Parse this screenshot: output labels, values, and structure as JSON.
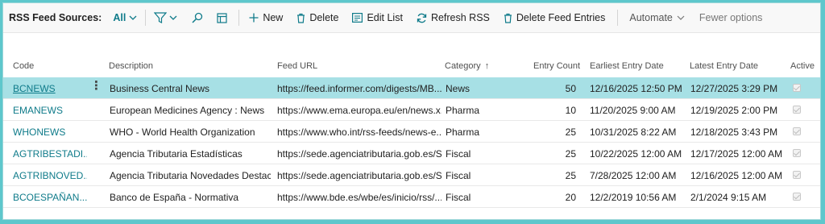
{
  "actionbar": {
    "title": "RSS Feed Sources:",
    "filter": "All",
    "buttons": {
      "new": "New",
      "delete": "Delete",
      "edit_list": "Edit List",
      "refresh_rss": "Refresh RSS",
      "delete_feed_entries": "Delete Feed Entries"
    },
    "automate": "Automate",
    "fewer_options": "Fewer options"
  },
  "columns": {
    "code": "Code",
    "description": "Description",
    "feed_url": "Feed URL",
    "category": "Category",
    "category_sort": "↑",
    "entry_count": "Entry Count",
    "earliest": "Earliest Entry Date",
    "latest": "Latest Entry Date",
    "active": "Active"
  },
  "rows": [
    {
      "code": "BCNEWS",
      "description": "Business Central News",
      "url": "https://feed.informer.com/digests/MB...",
      "category": "News",
      "count": "50",
      "earliest": "12/16/2025 12:50 PM",
      "latest": "12/27/2025 3:29 PM",
      "active": true
    },
    {
      "code": "EMANEWS",
      "description": "European Medicines Agency :  News",
      "url": "https://www.ema.europa.eu/en/news.x...",
      "category": "Pharma",
      "count": "10",
      "earliest": "11/20/2025 9:00 AM",
      "latest": "12/19/2025 2:00 PM",
      "active": true
    },
    {
      "code": "WHONEWS",
      "description": "WHO - World Health Organization",
      "url": "https://www.who.int/rss-feeds/news-e...",
      "category": "Pharma",
      "count": "25",
      "earliest": "10/31/2025 8:22 AM",
      "latest": "12/18/2025 3:43 PM",
      "active": true
    },
    {
      "code": "AGTRIBESTADI...",
      "description": "Agencia Tributaria Estadísticas",
      "url": "https://sede.agenciatributaria.gob.es/S...",
      "category": "Fiscal",
      "count": "25",
      "earliest": "10/22/2025 12:00 AM",
      "latest": "12/17/2025 12:00 AM",
      "active": true
    },
    {
      "code": "AGTRIBNOVED...",
      "description": "Agencia Tributaria Novedades Destaca...",
      "url": "https://sede.agenciatributaria.gob.es/S...",
      "category": "Fiscal",
      "count": "25",
      "earliest": "7/28/2025 12:00 AM",
      "latest": "12/16/2025 12:00 AM",
      "active": true
    },
    {
      "code": "BCOESPAÑAN...",
      "description": "Banco de España - Normativa",
      "url": "https://www.bde.es/wbe/es/inicio/rss/...",
      "category": "Fiscal",
      "count": "20",
      "earliest": "12/2/2019 10:56 AM",
      "latest": "2/1/2024 9:15 AM",
      "active": true
    }
  ]
}
